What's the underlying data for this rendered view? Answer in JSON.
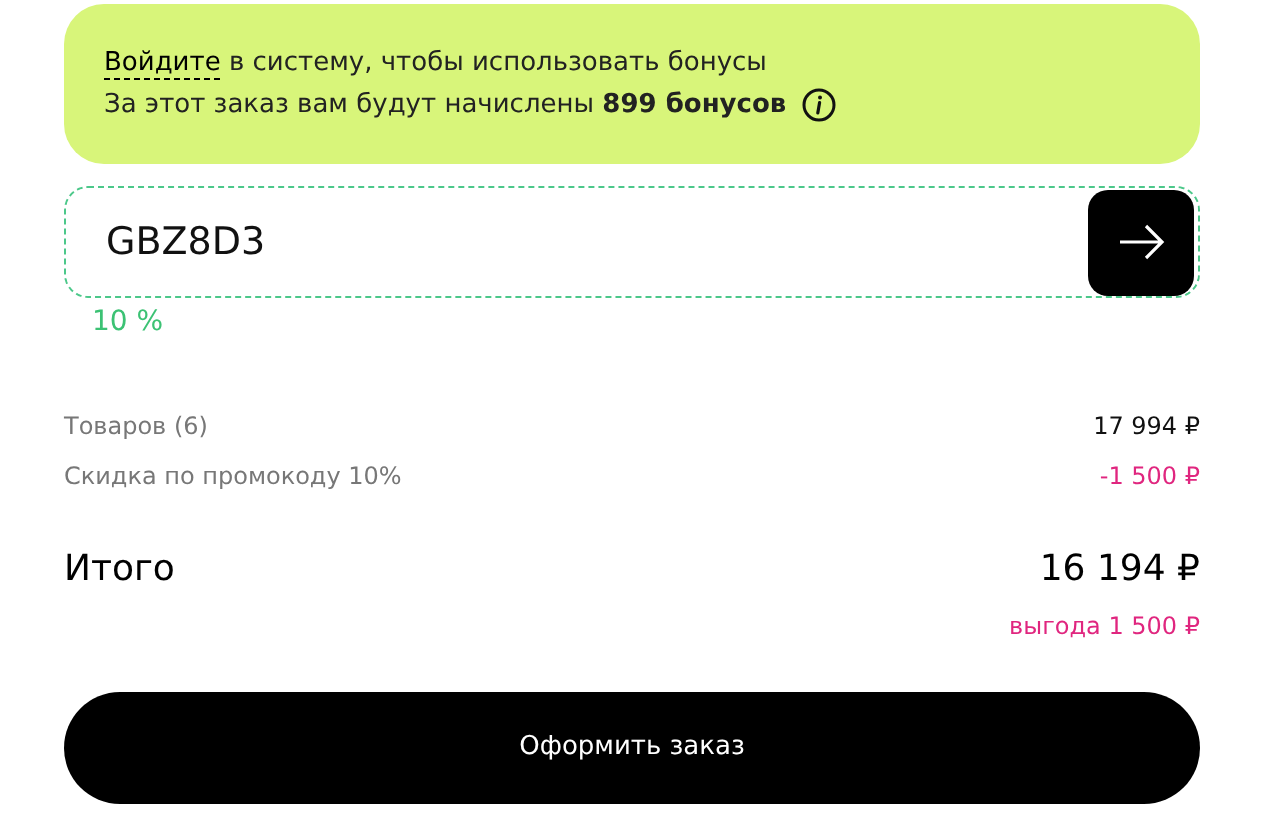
{
  "bonus_banner": {
    "login_link": "Войдите",
    "login_text": "в систему, чтобы использовать бонусы",
    "bonus_text": "За этот заказ вам будут начислены **899 бонусов**"
  },
  "promo": {
    "value": "GBZ8D3",
    "discount": "10 %"
  },
  "summary": [
    {
      "label": "Товаров (6)",
      "value": "17 994 ₽",
      "kind": "normal"
    },
    {
      "label": "Скидка по промокоду 10%",
      "value": "-1 500 ₽",
      "kind": "discount"
    }
  ],
  "total": {
    "label": "Итого",
    "value": "16 194 ₽",
    "savings": "выгода 1 500 ₽"
  },
  "checkout_button": "Оформить заказ"
}
